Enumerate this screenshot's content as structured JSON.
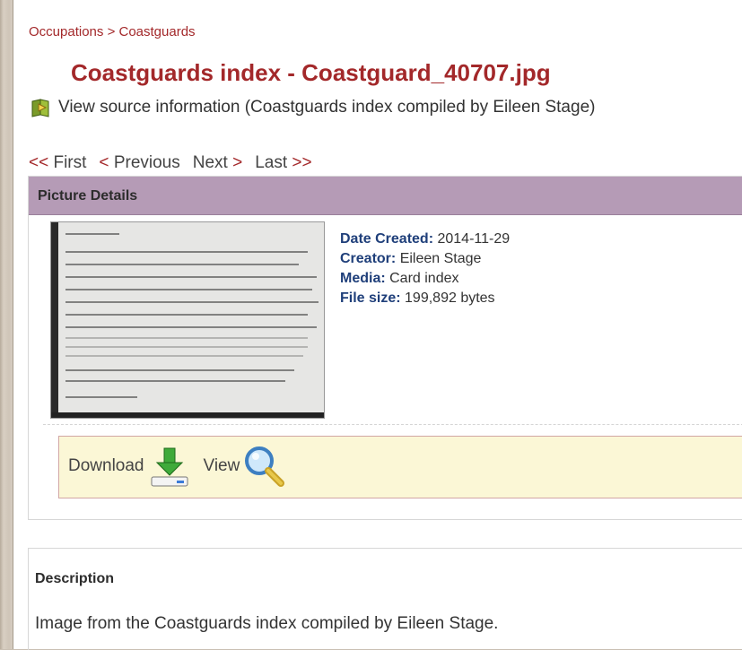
{
  "breadcrumb": {
    "parent": "Occupations",
    "separator": ">",
    "current": "Coastguards"
  },
  "title": "Coastguards index - Coastguard_40707.jpg",
  "source_link": {
    "icon": "book-icon",
    "text": "View source information (Coastguards index compiled by Eileen Stage)"
  },
  "pager": {
    "first_arrow": "<<",
    "first": "First",
    "previous_arrow": "<",
    "previous": "Previous",
    "next": "Next",
    "next_arrow": ">",
    "last": "Last",
    "last_arrow": ">>"
  },
  "picture_details": {
    "heading": "Picture Details",
    "thumbnail_alt": "index card",
    "fields": [
      {
        "label": "Date Created:",
        "value": "2014-11-29"
      },
      {
        "label": "Creator:",
        "value": "Eileen Stage"
      },
      {
        "label": "Media:",
        "value": "Card index"
      },
      {
        "label": "File size:",
        "value": "199,892 bytes"
      }
    ]
  },
  "actions": {
    "download": "Download",
    "download_icon": "download-icon",
    "view": "View",
    "view_icon": "magnifier-icon"
  },
  "description": {
    "heading": "Description",
    "text": "Image from the Coastguards index compiled by Eileen Stage."
  },
  "colors": {
    "link_red": "#a3282a",
    "header_purple": "#b59bb6",
    "label_blue": "#1f3f7a",
    "action_bg": "#fbf7d6"
  }
}
